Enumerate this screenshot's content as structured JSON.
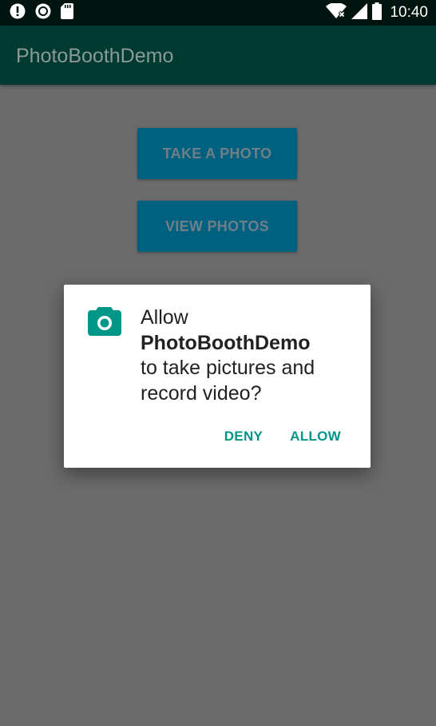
{
  "status_bar": {
    "time": "10:40",
    "left_icons": [
      "alert-icon",
      "circle-notification-icon",
      "sd-card-icon"
    ],
    "right_icons": [
      "wifi-no-internet-icon",
      "cellular-signal-icon",
      "battery-icon"
    ]
  },
  "app_bar": {
    "title": "PhotoBoothDemo"
  },
  "main": {
    "take_photo_label": "TAKE A PHOTO",
    "view_photos_label": "VIEW PHOTOS"
  },
  "dialog": {
    "icon": "camera-icon",
    "line1": "Allow",
    "app_name": "PhotoBoothDemo",
    "line3": "to take pictures and record video?",
    "deny_label": "DENY",
    "allow_label": "ALLOW"
  },
  "colors": {
    "accent": "#009688",
    "status_bar": "#00140f",
    "app_bar": "#003a31",
    "button": "#006080",
    "scrim_background": "#6b6b6b"
  }
}
